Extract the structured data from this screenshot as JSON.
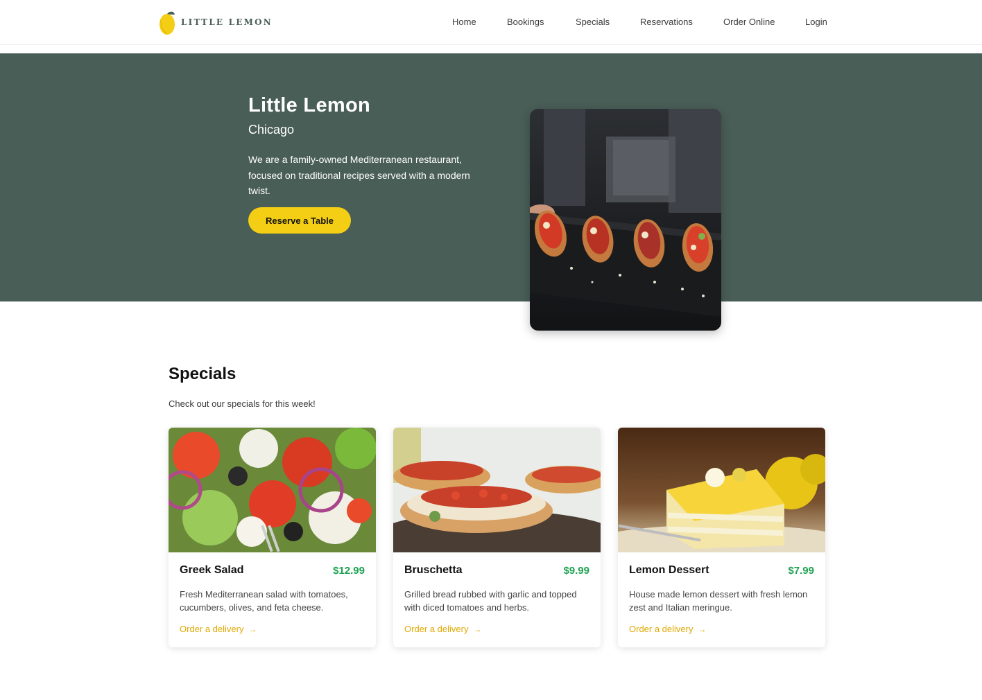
{
  "header": {
    "logo_text": "LITTLE LEMON",
    "nav": [
      "Home",
      "Bookings",
      "Specials",
      "Reservations",
      "Order Online",
      "Login"
    ]
  },
  "hero": {
    "title": "Little Lemon",
    "subtitle": "Chicago",
    "description": "We are a family-owned Mediterranean restaurant, focused on traditional recipes served with a modern twist.",
    "button": "Reserve a Table"
  },
  "specials": {
    "title": "Specials",
    "subtitle": "Check out our specials for this week!",
    "items": [
      {
        "name": "Greek Salad",
        "price": "$12.99",
        "description": "Fresh Mediterranean salad with tomatoes, cucumbers, olives, and feta cheese.",
        "link": "Order a delivery"
      },
      {
        "name": "Bruschetta",
        "price": "$9.99",
        "description": "Grilled bread rubbed with garlic and topped with diced tomatoes and herbs.",
        "link": "Order a delivery"
      },
      {
        "name": "Lemon Dessert",
        "price": "$7.99",
        "description": "House made lemon dessert with fresh lemon zest and Italian meringue.",
        "link": "Order a delivery"
      }
    ]
  },
  "colors": {
    "primary_green": "#495E57",
    "primary_yellow": "#F4CE14",
    "price_green": "#1FA351",
    "link_gold": "#E0A800"
  }
}
